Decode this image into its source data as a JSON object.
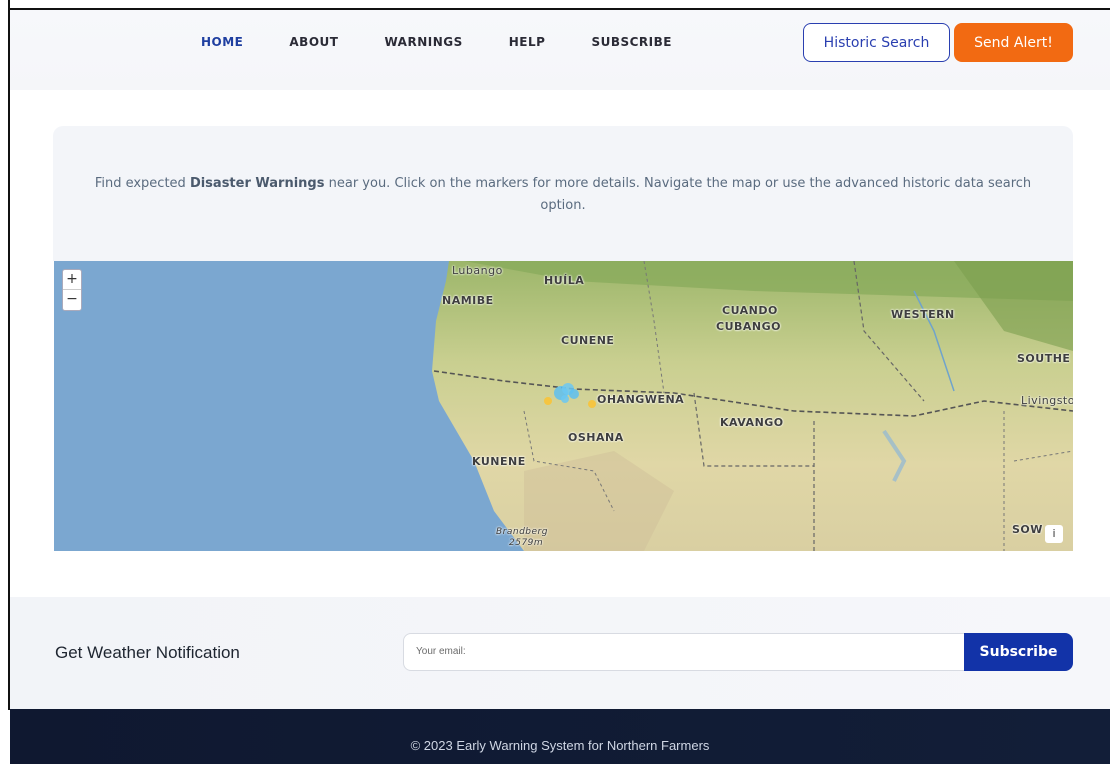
{
  "nav": {
    "items": [
      {
        "label": "HOME",
        "active": true
      },
      {
        "label": "ABOUT",
        "active": false
      },
      {
        "label": "WARNINGS",
        "active": false
      },
      {
        "label": "HELP",
        "active": false
      },
      {
        "label": "SUBSCRIBE",
        "active": false
      }
    ],
    "historic_label": "Historic Search",
    "alert_label": "Send Alert!"
  },
  "intro": {
    "prefix": "Find expected ",
    "highlight": "Disaster Warnings",
    "suffix": " near you. Click on the markers for more details. Navigate the map or use the advanced historic data search option."
  },
  "map": {
    "zoom_in": "+",
    "zoom_out": "−",
    "info": "i",
    "labels": {
      "lubango": "Lubango",
      "huila": "HUÍLA",
      "namibe": "NAMIBE",
      "cuando": "CUANDO",
      "cubango": "CUBANGO",
      "western": "WESTERN",
      "cunene": "CUNENE",
      "southe": "SOUTHE",
      "ohangwena": "OHANGWENA",
      "livingston": "Livingston",
      "kavango": "KAVANGO",
      "oshana": "OSHANA",
      "kunene": "KUNENE",
      "brandberg": "Brandberg",
      "brandberg_h": "2579m",
      "sow": "SOW"
    }
  },
  "notify": {
    "title": "Get Weather Notification",
    "email_placeholder": "Your email:",
    "subscribe_label": "Subscribe"
  },
  "footer": {
    "text": "© 2023 Early Warning System for Northern Farmers"
  },
  "colors": {
    "brand_blue": "#1233a8",
    "alert_orange": "#f26a12",
    "footer_bg": "#0f1830"
  }
}
